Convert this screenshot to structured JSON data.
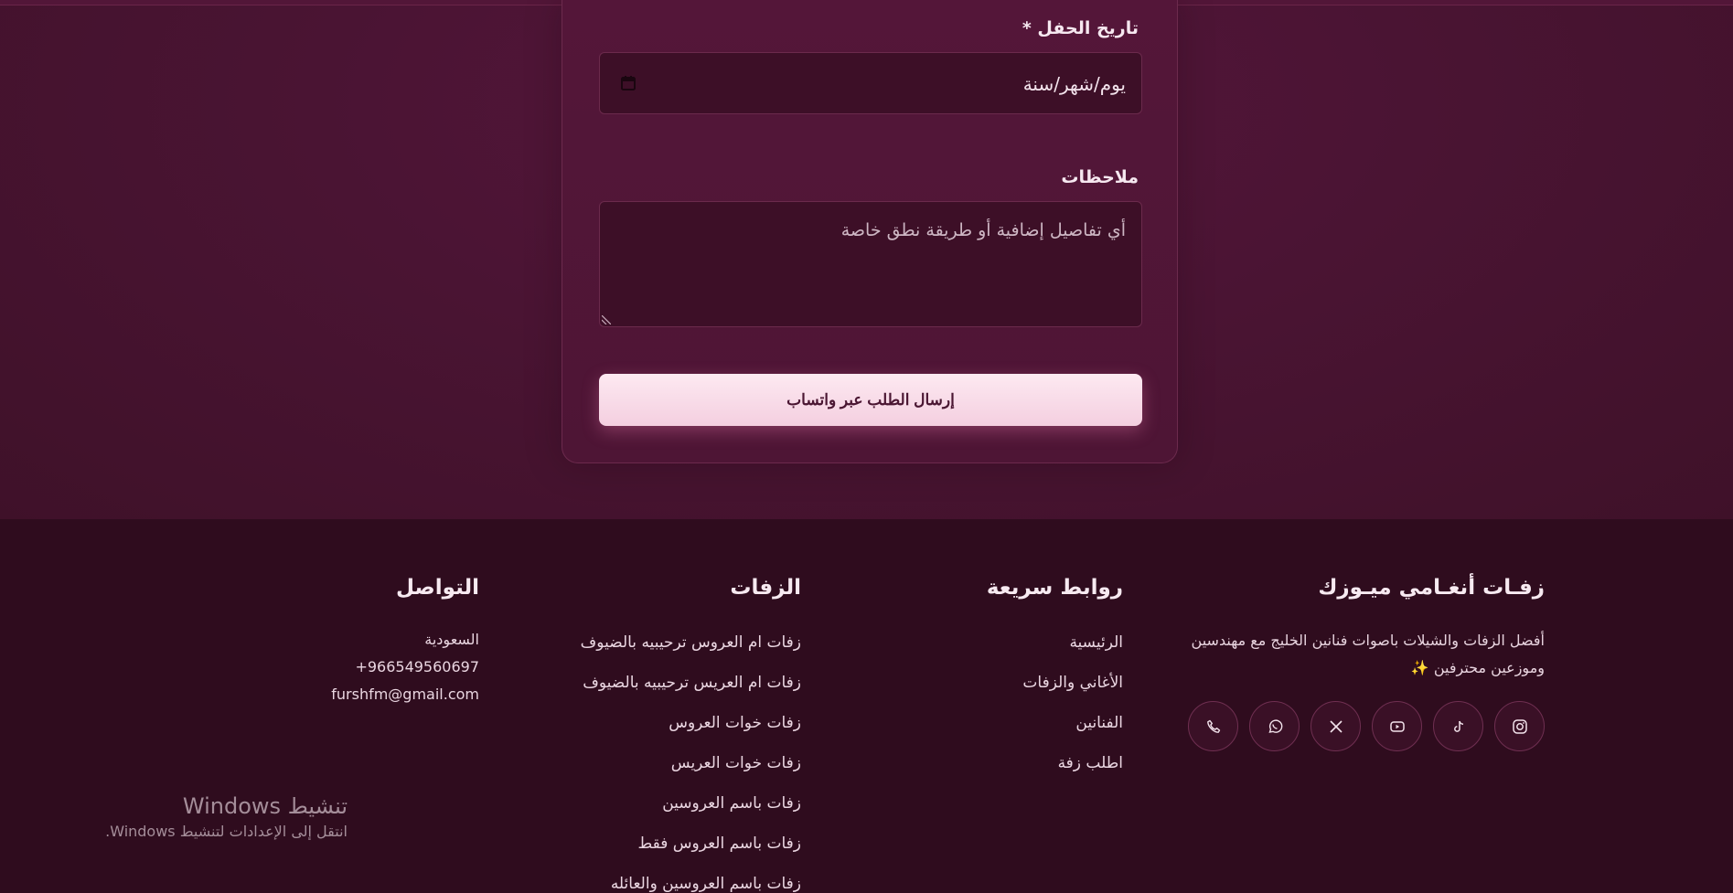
{
  "form": {
    "date_label": "تاريخ الحفل *",
    "date_value": "يوم/شهر/سنة",
    "notes_label": "ملاحظات",
    "notes_placeholder": "أي تفاصيل إضافية أو طريقة نطق خاصة",
    "submit_label": "إرسال الطلب عبر واتساب"
  },
  "footer": {
    "brand": {
      "name": "زفـات أنغـامي ميـوزك",
      "tagline": "أفضل الزفات والشيلات باصوات فنانين الخليج مع مهندسين وموزعين محترفين ✨"
    },
    "socials": [
      {
        "icon": "instagram-icon"
      },
      {
        "icon": "tiktok-icon"
      },
      {
        "icon": "youtube-icon"
      },
      {
        "icon": "x-icon"
      },
      {
        "icon": "whatsapp-icon"
      },
      {
        "icon": "phone-icon"
      }
    ],
    "quick_links": {
      "title": "روابط سريعة",
      "items": [
        "الرئيسية",
        "الأغاني والزفات",
        "الفنانين",
        "اطلب زفة"
      ]
    },
    "weddings": {
      "title": "الزفات",
      "items": [
        "زفات ام العروس ترحيبيه بالضيوف",
        "زفات ام العريس ترحيبيه بالضيوف",
        "زفات خوات العروس",
        "زفات خوات العريس",
        "زفات باسم العروسين",
        "زفات باسم العروس فقط",
        "زفات باسم العروسين والعائله"
      ]
    },
    "contact": {
      "title": "التواصل",
      "items": [
        "السعودية",
        "+966549560697",
        "furshfm@gmail.com"
      ]
    }
  },
  "windows_activation": {
    "title": "تنشيط Windows",
    "subtitle": "انتقل إلى الإعدادات لتنشيط Windows."
  }
}
